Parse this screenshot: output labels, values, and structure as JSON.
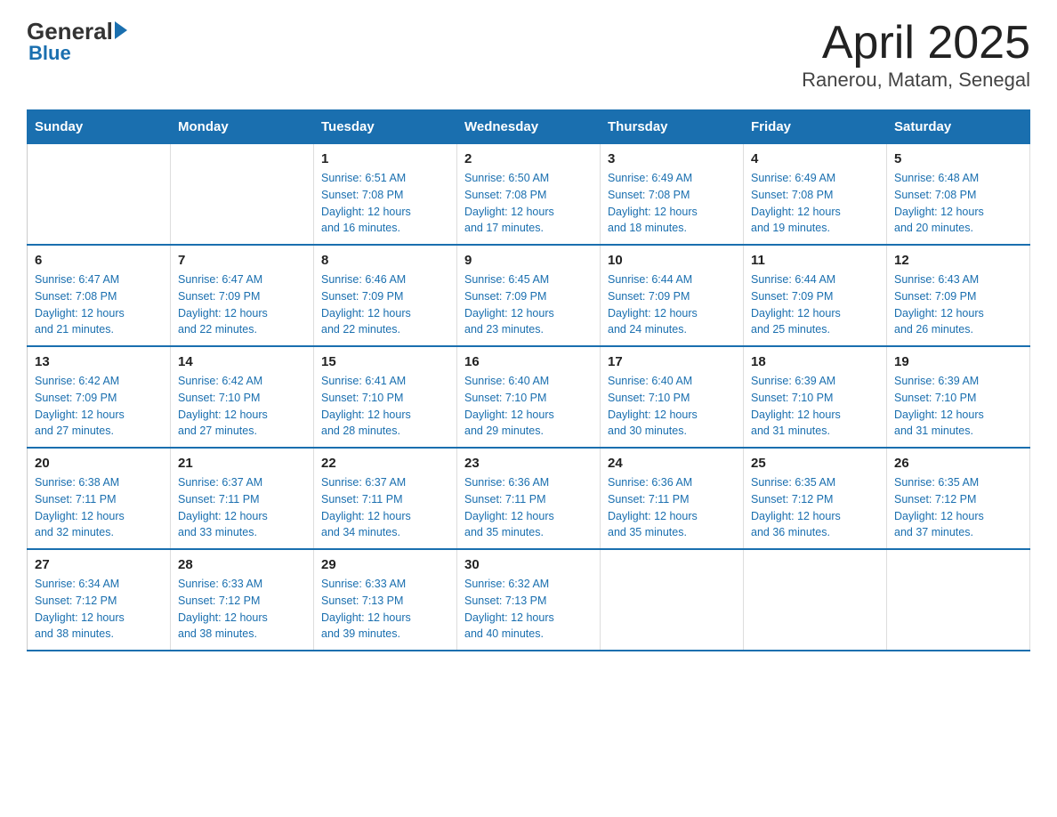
{
  "header": {
    "logo_general": "General",
    "logo_blue": "Blue",
    "title": "April 2025",
    "subtitle": "Ranerou, Matam, Senegal"
  },
  "calendar": {
    "days_of_week": [
      "Sunday",
      "Monday",
      "Tuesday",
      "Wednesday",
      "Thursday",
      "Friday",
      "Saturday"
    ],
    "weeks": [
      [
        {
          "day": "",
          "info": ""
        },
        {
          "day": "",
          "info": ""
        },
        {
          "day": "1",
          "info": "Sunrise: 6:51 AM\nSunset: 7:08 PM\nDaylight: 12 hours\nand 16 minutes."
        },
        {
          "day": "2",
          "info": "Sunrise: 6:50 AM\nSunset: 7:08 PM\nDaylight: 12 hours\nand 17 minutes."
        },
        {
          "day": "3",
          "info": "Sunrise: 6:49 AM\nSunset: 7:08 PM\nDaylight: 12 hours\nand 18 minutes."
        },
        {
          "day": "4",
          "info": "Sunrise: 6:49 AM\nSunset: 7:08 PM\nDaylight: 12 hours\nand 19 minutes."
        },
        {
          "day": "5",
          "info": "Sunrise: 6:48 AM\nSunset: 7:08 PM\nDaylight: 12 hours\nand 20 minutes."
        }
      ],
      [
        {
          "day": "6",
          "info": "Sunrise: 6:47 AM\nSunset: 7:08 PM\nDaylight: 12 hours\nand 21 minutes."
        },
        {
          "day": "7",
          "info": "Sunrise: 6:47 AM\nSunset: 7:09 PM\nDaylight: 12 hours\nand 22 minutes."
        },
        {
          "day": "8",
          "info": "Sunrise: 6:46 AM\nSunset: 7:09 PM\nDaylight: 12 hours\nand 22 minutes."
        },
        {
          "day": "9",
          "info": "Sunrise: 6:45 AM\nSunset: 7:09 PM\nDaylight: 12 hours\nand 23 minutes."
        },
        {
          "day": "10",
          "info": "Sunrise: 6:44 AM\nSunset: 7:09 PM\nDaylight: 12 hours\nand 24 minutes."
        },
        {
          "day": "11",
          "info": "Sunrise: 6:44 AM\nSunset: 7:09 PM\nDaylight: 12 hours\nand 25 minutes."
        },
        {
          "day": "12",
          "info": "Sunrise: 6:43 AM\nSunset: 7:09 PM\nDaylight: 12 hours\nand 26 minutes."
        }
      ],
      [
        {
          "day": "13",
          "info": "Sunrise: 6:42 AM\nSunset: 7:09 PM\nDaylight: 12 hours\nand 27 minutes."
        },
        {
          "day": "14",
          "info": "Sunrise: 6:42 AM\nSunset: 7:10 PM\nDaylight: 12 hours\nand 27 minutes."
        },
        {
          "day": "15",
          "info": "Sunrise: 6:41 AM\nSunset: 7:10 PM\nDaylight: 12 hours\nand 28 minutes."
        },
        {
          "day": "16",
          "info": "Sunrise: 6:40 AM\nSunset: 7:10 PM\nDaylight: 12 hours\nand 29 minutes."
        },
        {
          "day": "17",
          "info": "Sunrise: 6:40 AM\nSunset: 7:10 PM\nDaylight: 12 hours\nand 30 minutes."
        },
        {
          "day": "18",
          "info": "Sunrise: 6:39 AM\nSunset: 7:10 PM\nDaylight: 12 hours\nand 31 minutes."
        },
        {
          "day": "19",
          "info": "Sunrise: 6:39 AM\nSunset: 7:10 PM\nDaylight: 12 hours\nand 31 minutes."
        }
      ],
      [
        {
          "day": "20",
          "info": "Sunrise: 6:38 AM\nSunset: 7:11 PM\nDaylight: 12 hours\nand 32 minutes."
        },
        {
          "day": "21",
          "info": "Sunrise: 6:37 AM\nSunset: 7:11 PM\nDaylight: 12 hours\nand 33 minutes."
        },
        {
          "day": "22",
          "info": "Sunrise: 6:37 AM\nSunset: 7:11 PM\nDaylight: 12 hours\nand 34 minutes."
        },
        {
          "day": "23",
          "info": "Sunrise: 6:36 AM\nSunset: 7:11 PM\nDaylight: 12 hours\nand 35 minutes."
        },
        {
          "day": "24",
          "info": "Sunrise: 6:36 AM\nSunset: 7:11 PM\nDaylight: 12 hours\nand 35 minutes."
        },
        {
          "day": "25",
          "info": "Sunrise: 6:35 AM\nSunset: 7:12 PM\nDaylight: 12 hours\nand 36 minutes."
        },
        {
          "day": "26",
          "info": "Sunrise: 6:35 AM\nSunset: 7:12 PM\nDaylight: 12 hours\nand 37 minutes."
        }
      ],
      [
        {
          "day": "27",
          "info": "Sunrise: 6:34 AM\nSunset: 7:12 PM\nDaylight: 12 hours\nand 38 minutes."
        },
        {
          "day": "28",
          "info": "Sunrise: 6:33 AM\nSunset: 7:12 PM\nDaylight: 12 hours\nand 38 minutes."
        },
        {
          "day": "29",
          "info": "Sunrise: 6:33 AM\nSunset: 7:13 PM\nDaylight: 12 hours\nand 39 minutes."
        },
        {
          "day": "30",
          "info": "Sunrise: 6:32 AM\nSunset: 7:13 PM\nDaylight: 12 hours\nand 40 minutes."
        },
        {
          "day": "",
          "info": ""
        },
        {
          "day": "",
          "info": ""
        },
        {
          "day": "",
          "info": ""
        }
      ]
    ]
  }
}
